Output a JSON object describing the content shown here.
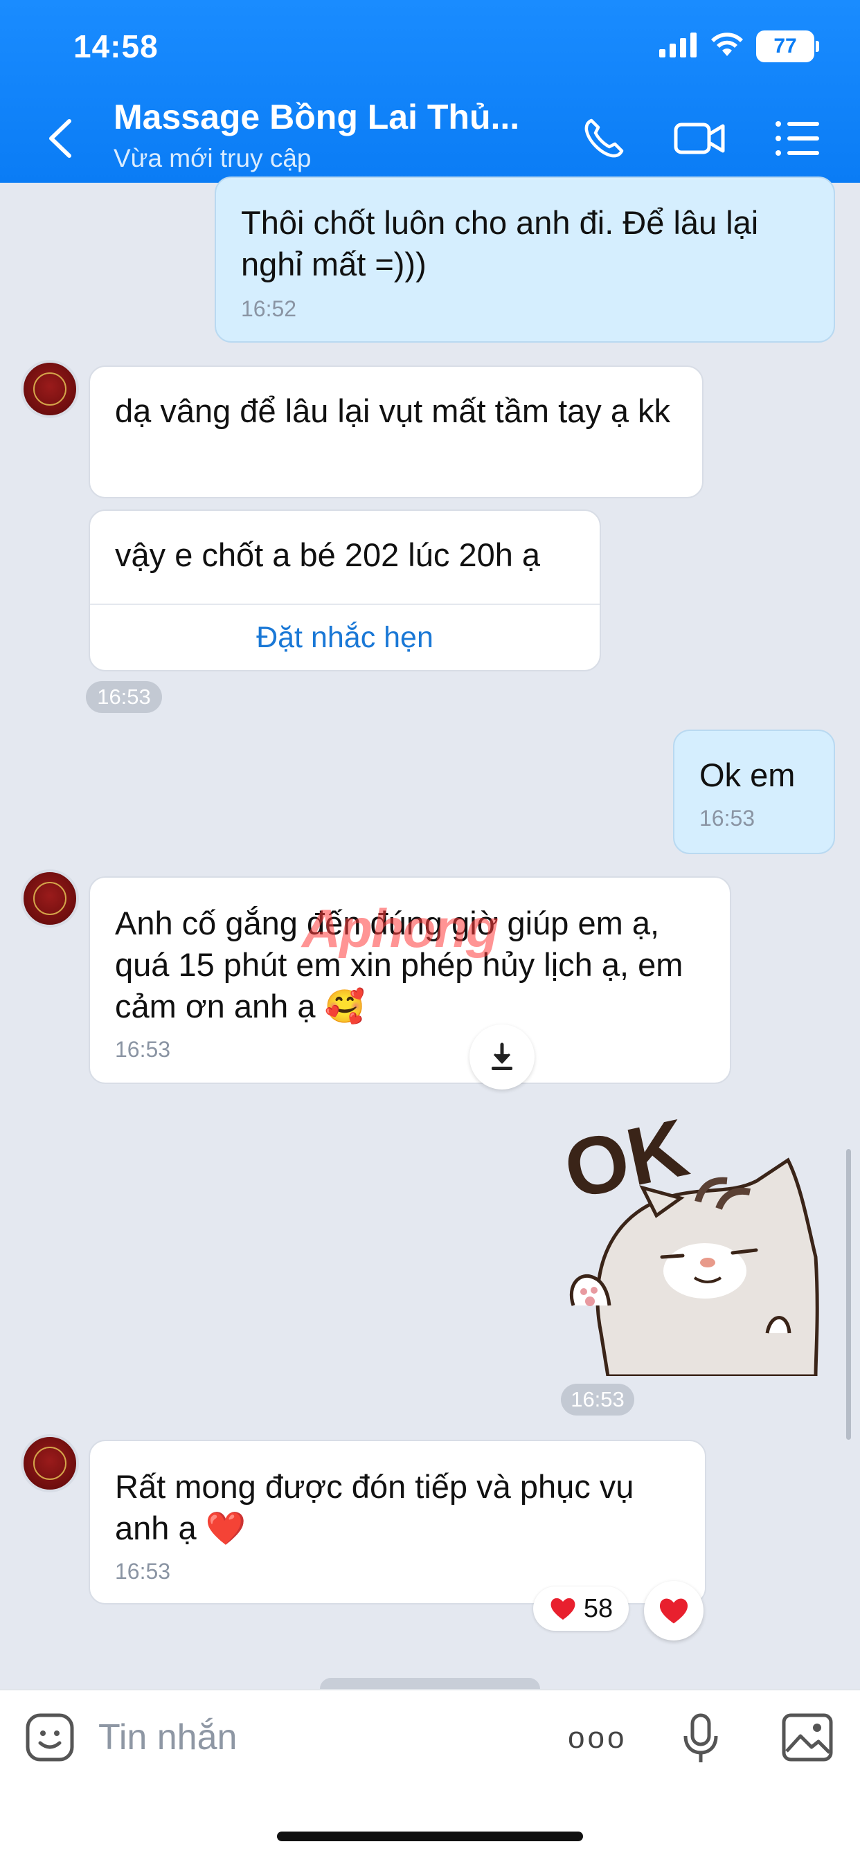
{
  "status_bar": {
    "time": "14:58",
    "battery": "77"
  },
  "header": {
    "title": "Massage Bồng Lai Thủ...",
    "subtitle": "Vừa mới truy cập"
  },
  "messages": {
    "m1": {
      "text": "Thôi chốt luôn cho anh đi. Để lâu lại nghỉ mất =)))",
      "time": "16:52"
    },
    "m2": {
      "text": "dạ vâng để lâu lại vụt mất tầm tay ạ kk"
    },
    "m3": {
      "text": "vậy e chốt a bé 202 lúc 20h ạ",
      "action": "Đặt nhắc hẹn"
    },
    "t1": "16:53",
    "m4": {
      "text": "Ok em",
      "time": "16:53"
    },
    "m5": {
      "text": "Anh cố gắng đến đúng giờ giúp em ạ, quá 15 phút em xin phép hủy lịch ạ, em cảm ơn anh ạ 🥰",
      "time": "16:53"
    },
    "sticker": {
      "text": "OK",
      "time": "16:53"
    },
    "m6": {
      "text": "Rất mong được đón tiếp và phục vụ anh ạ ❤️",
      "time": "16:53",
      "reaction_count": "58"
    }
  },
  "watermark": "Aphong",
  "input": {
    "placeholder": "Tin nhắn",
    "more": "ooo"
  },
  "colors": {
    "header": "#0a7cf5",
    "outgoing_bubble": "#d5eefe",
    "incoming_bubble": "#ffffff",
    "link": "#1a78d6",
    "heart": "#e8202e"
  }
}
